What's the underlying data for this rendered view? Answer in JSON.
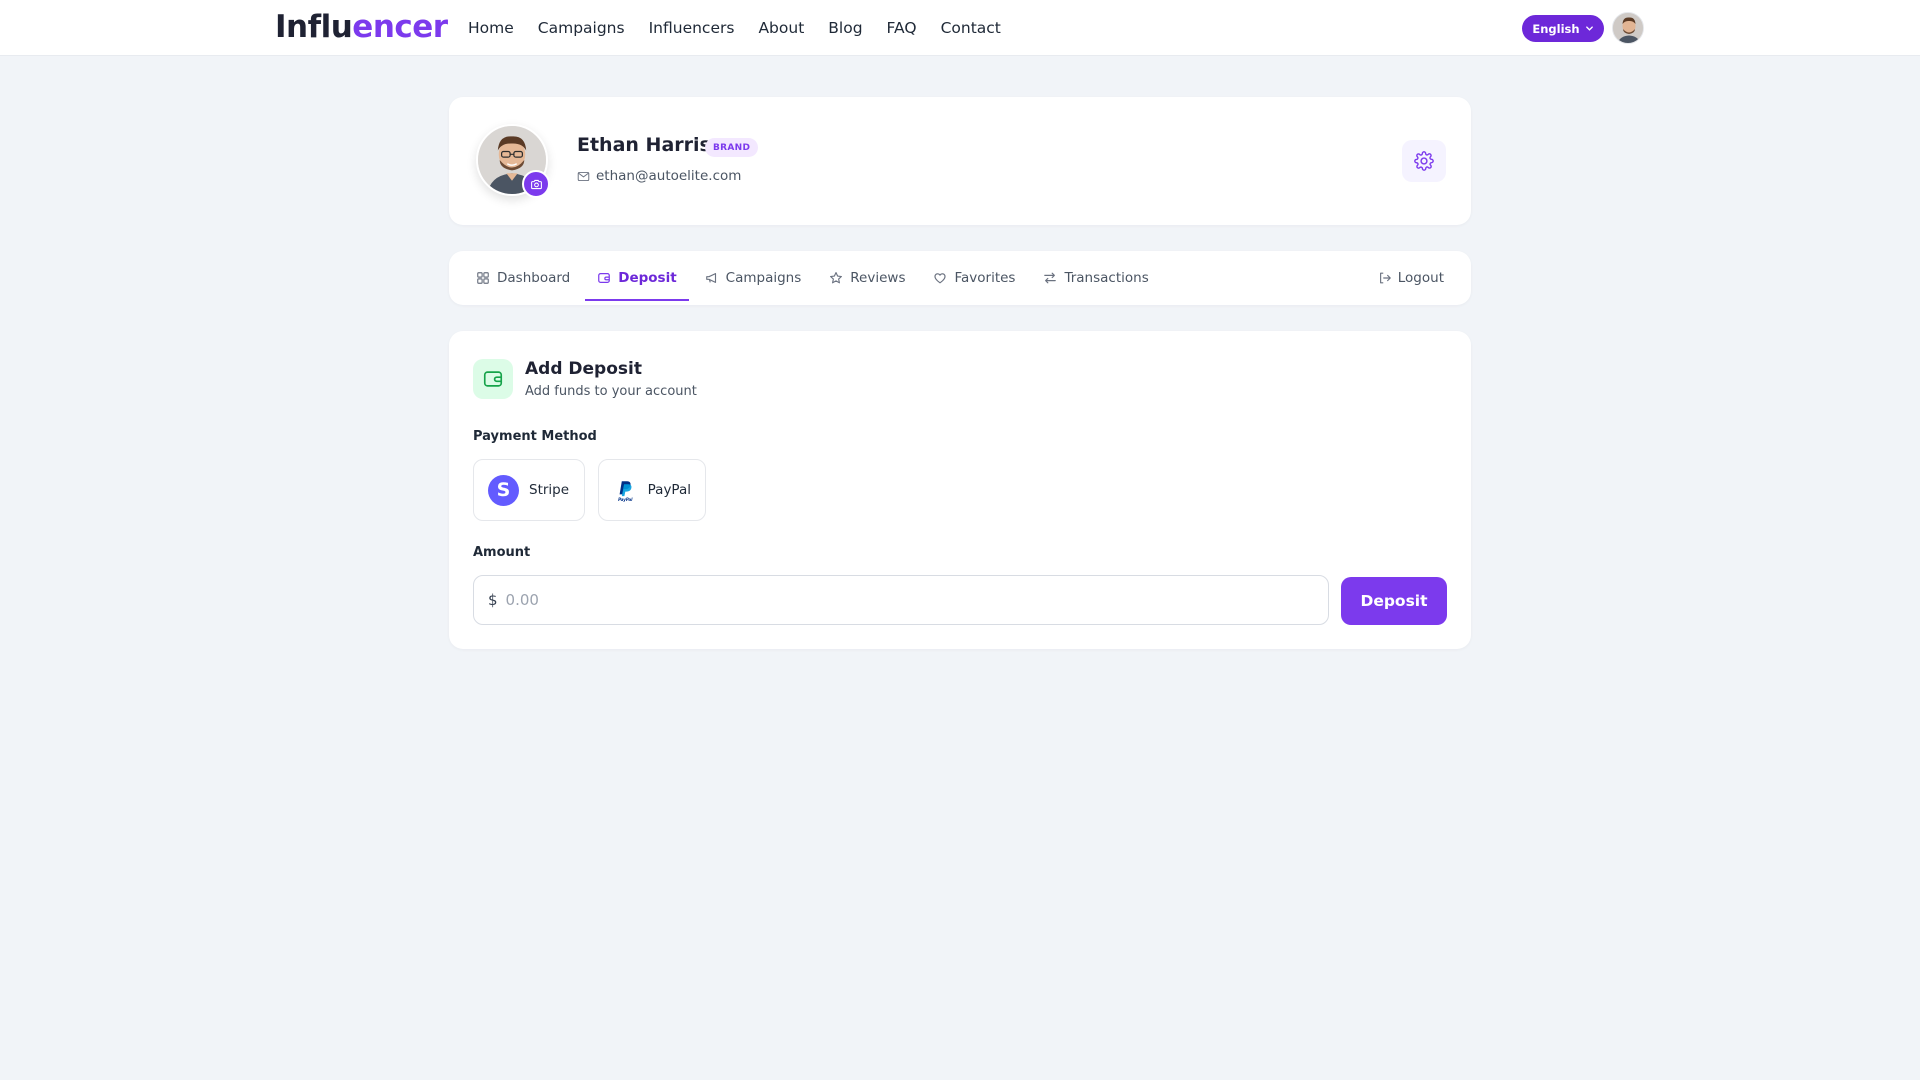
{
  "header": {
    "logo_prefix": "Influ",
    "logo_accent": "encer",
    "nav": [
      "Home",
      "Campaigns",
      "Influencers",
      "About",
      "Blog",
      "FAQ",
      "Contact"
    ],
    "language": "English"
  },
  "profile": {
    "name": "Ethan Harris",
    "role_badge": "BRAND",
    "email": "ethan@autoelite.com"
  },
  "tabs": {
    "items": [
      {
        "label": "Dashboard",
        "icon": "grid-icon"
      },
      {
        "label": "Deposit",
        "icon": "wallet-icon",
        "active": true
      },
      {
        "label": "Campaigns",
        "icon": "megaphone-icon"
      },
      {
        "label": "Reviews",
        "icon": "star-icon"
      },
      {
        "label": "Favorites",
        "icon": "heart-icon"
      },
      {
        "label": "Transactions",
        "icon": "arrows-icon"
      }
    ],
    "logout": "Logout"
  },
  "deposit": {
    "title": "Add Deposit",
    "subtitle": "Add funds to your account",
    "payment_method_label": "Payment Method",
    "methods": [
      "Stripe",
      "PayPal"
    ],
    "amount_label": "Amount",
    "currency_symbol": "$",
    "amount_placeholder": "0.00",
    "button": "Deposit"
  },
  "colors": {
    "accent": "#7c3aed",
    "background": "#f1f4f8",
    "deposit_icon_bg": "#dcfce7",
    "deposit_icon": "#16a34a"
  }
}
